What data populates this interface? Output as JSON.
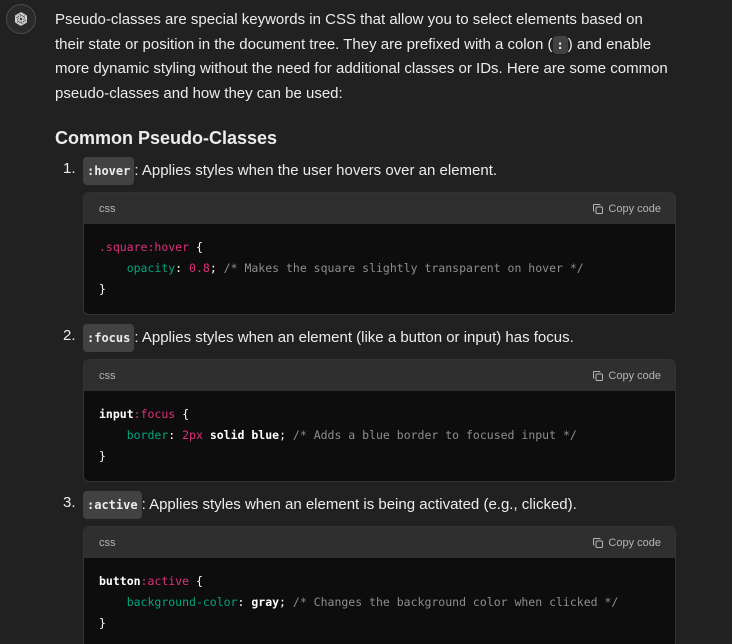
{
  "intro": {
    "part1": "Pseudo-classes are special keywords in CSS that allow you to select elements based on their state or position in the document tree. They are prefixed with a colon (",
    "colon": ":",
    "part2": ") and enable more dynamic styling without the need for additional classes or IDs. Here are some common pseudo-classes and how they can be used:"
  },
  "section_title": "Common Pseudo-Classes",
  "items": [
    {
      "number": "1.",
      "code": ":hover",
      "desc": ": Applies styles when the user hovers over an element.",
      "lang": "css",
      "copy_label": "Copy code",
      "code_lines": {
        "l1_sel": ".square",
        "l1_pseudo": ":hover",
        "l1_brace": " {",
        "l2_prop": "opacity",
        "l2_colon": ": ",
        "l2_value": "0.8",
        "l2_semi": "; ",
        "l2_comment": "/* Makes the square slightly transparent on hover */",
        "l3": "}"
      }
    },
    {
      "number": "2.",
      "code": ":focus",
      "desc": ": Applies styles when an element (like a button or input) has focus.",
      "lang": "css",
      "copy_label": "Copy code",
      "code_lines": {
        "l1_sel": "input",
        "l1_pseudo": ":focus",
        "l1_brace": " {",
        "l2_prop": "border",
        "l2_colon": ": ",
        "l2_value": "2px",
        "l2_rest": " solid blue",
        "l2_semi": "; ",
        "l2_comment": "/* Adds a blue border to focused input */",
        "l3": "}"
      }
    },
    {
      "number": "3.",
      "code": ":active",
      "desc": ": Applies styles when an element is being activated (e.g., clicked).",
      "lang": "css",
      "copy_label": "Copy code",
      "code_lines": {
        "l1_sel": "button",
        "l1_pseudo": ":active",
        "l1_brace": " {",
        "l2_prop": "background-color",
        "l2_colon": ": ",
        "l2_rest": "gray",
        "l2_semi": "; ",
        "l2_comment": "/* Changes the background color when clicked */",
        "l3": "}"
      }
    }
  ],
  "colors": {
    "background": "#212121",
    "code_bg": "#0d0d0d",
    "code_header": "#2f2f2f",
    "selector_pink": "#df3079",
    "property_green": "#00a67d",
    "comment_gray": "#8e8e8e"
  }
}
